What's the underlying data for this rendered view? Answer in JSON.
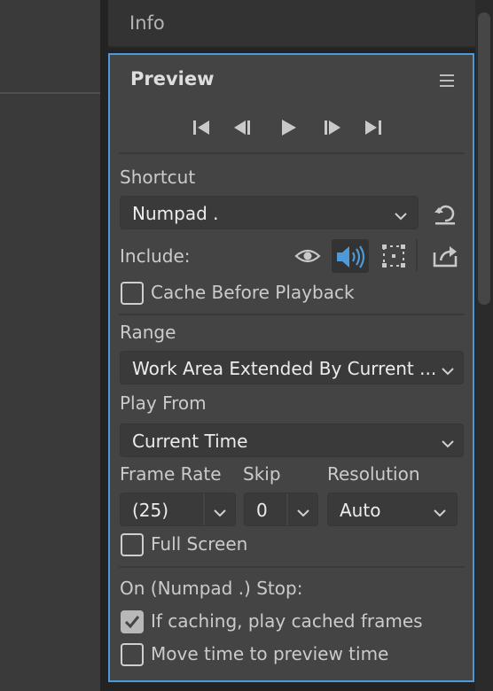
{
  "info": {
    "title": "Info"
  },
  "preview": {
    "title": "Preview",
    "menu_icon": "hamburger-menu-icon",
    "transport": [
      {
        "name": "first-frame",
        "icon": "skip-to-start-icon"
      },
      {
        "name": "previous-frame",
        "icon": "step-back-icon"
      },
      {
        "name": "play",
        "icon": "play-icon"
      },
      {
        "name": "next-frame",
        "icon": "step-forward-icon"
      },
      {
        "name": "last-frame",
        "icon": "skip-to-end-icon"
      }
    ],
    "shortcut": {
      "label": "Shortcut",
      "value": "Numpad .",
      "reset_icon": "reset-icon"
    },
    "include": {
      "label": "Include:",
      "icons": [
        "eye-icon",
        "speaker-icon",
        "overlay-frame-icon",
        "export-icon"
      ]
    },
    "cache_before_playback": {
      "label": "Cache Before Playback",
      "checked": false
    },
    "range": {
      "label": "Range",
      "value": "Work Area Extended By Current ..."
    },
    "play_from": {
      "label": "Play From",
      "value": "Current Time"
    },
    "frame_rate": {
      "label": "Frame Rate",
      "value": "(25)"
    },
    "skip": {
      "label": "Skip",
      "value": "0"
    },
    "resolution": {
      "label": "Resolution",
      "value": "Auto"
    },
    "full_screen": {
      "label": "Full Screen",
      "checked": false
    },
    "on_stop": {
      "label": "On (Numpad .) Stop:",
      "play_cached": {
        "label": "If caching, play cached frames",
        "checked": true
      },
      "move_time": {
        "label": "Move time to preview time",
        "checked": false
      }
    },
    "accent_color": "#4e9ad8"
  }
}
